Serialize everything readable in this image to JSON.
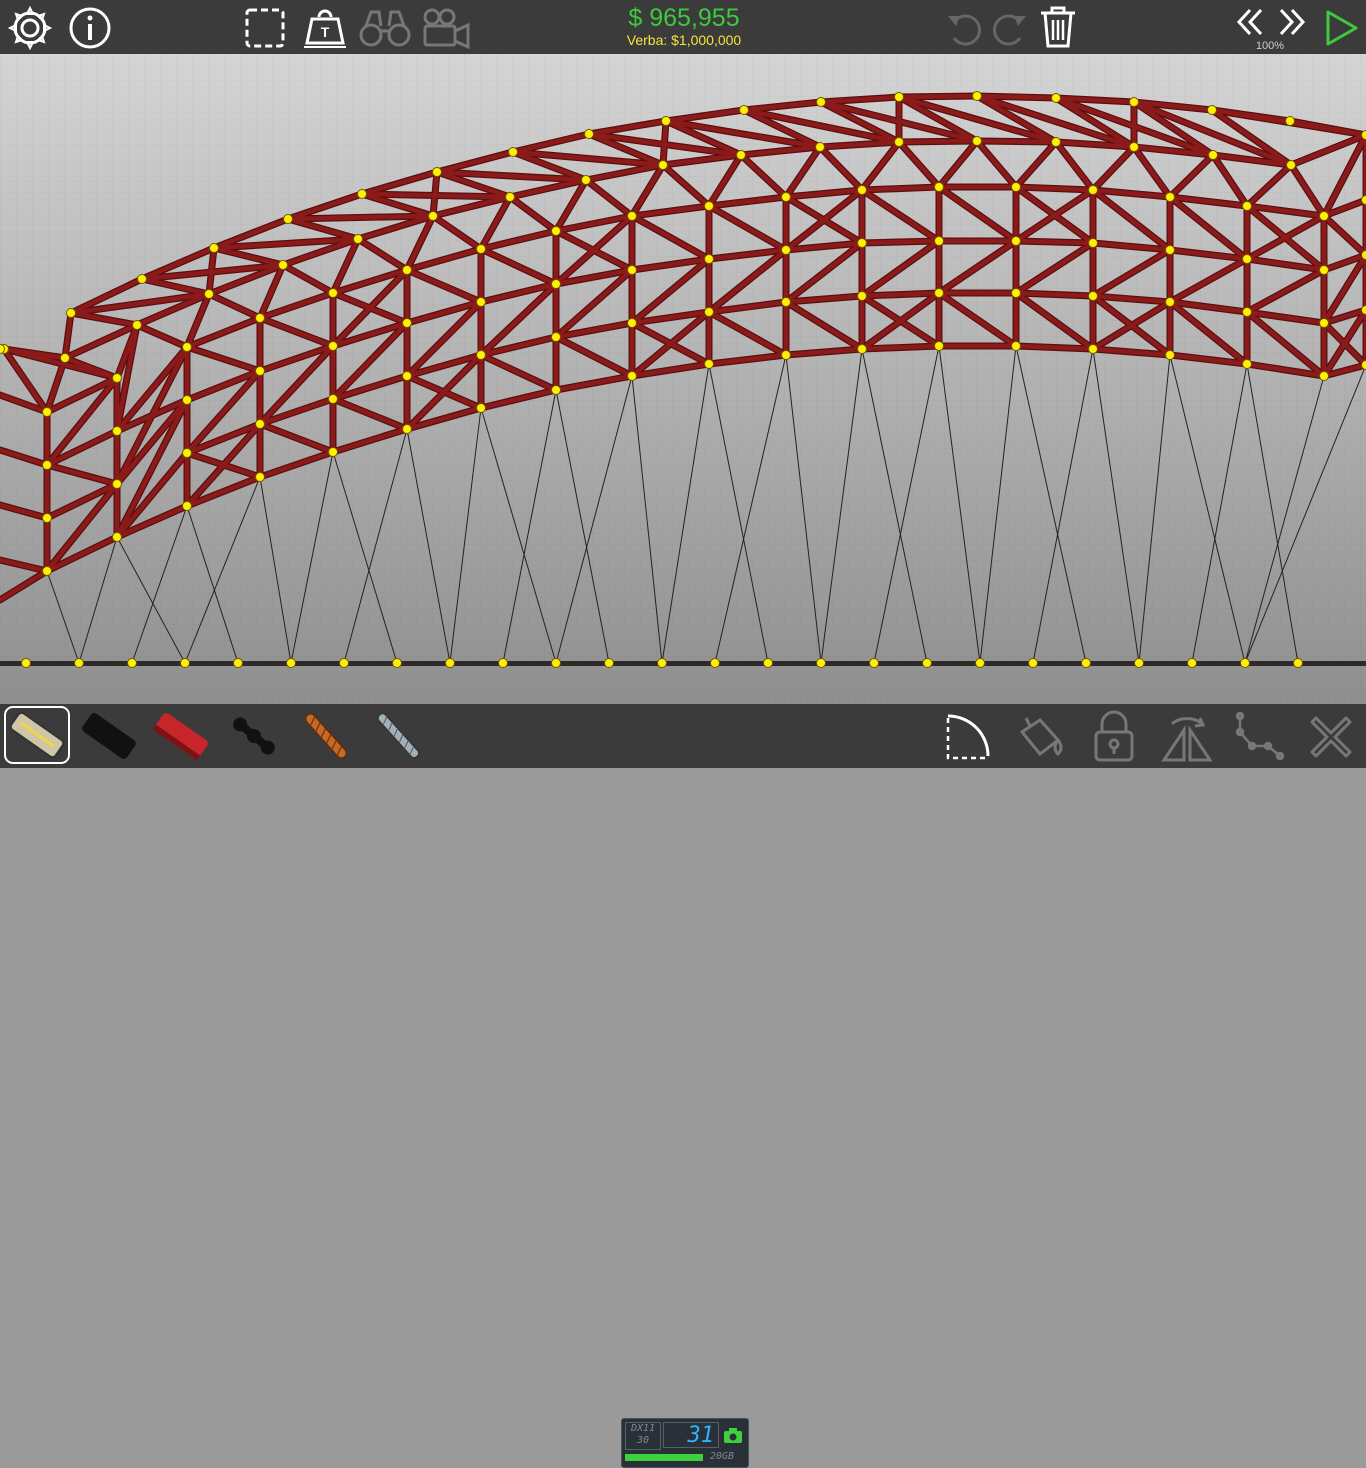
{
  "budget": {
    "money": "$ 965,955",
    "verba": "Verba: $1,000,000"
  },
  "simulation": {
    "speed_label": "100%"
  },
  "toolbar_top": {
    "left_icons": [
      "settings-icon",
      "info-icon",
      "selection-box-icon",
      "weight-icon",
      "binoculars-icon",
      "camera-icon"
    ],
    "right_icons": [
      "undo-icon",
      "redo-icon",
      "trash-icon",
      "slow-down-icon",
      "speed-up-icon",
      "play-icon"
    ]
  },
  "materials": [
    "road",
    "reinforced-road",
    "wood",
    "steel",
    "rope",
    "cable"
  ],
  "selected_material": "road",
  "bottom_tools": [
    "arc-tool-icon",
    "paint-bucket-icon",
    "lock-icon",
    "mirror-icon",
    "split-joint-icon",
    "close-icon"
  ],
  "perf_overlay": {
    "api": "DX11",
    "api_value": "30",
    "fps": "31",
    "memory": "20GB"
  },
  "colors": {
    "beam": "#8b1a1a",
    "joint": "#ffef00",
    "money": "#3ec93e",
    "verba": "#f3e53b",
    "toolbar": "#3b3b3b"
  }
}
